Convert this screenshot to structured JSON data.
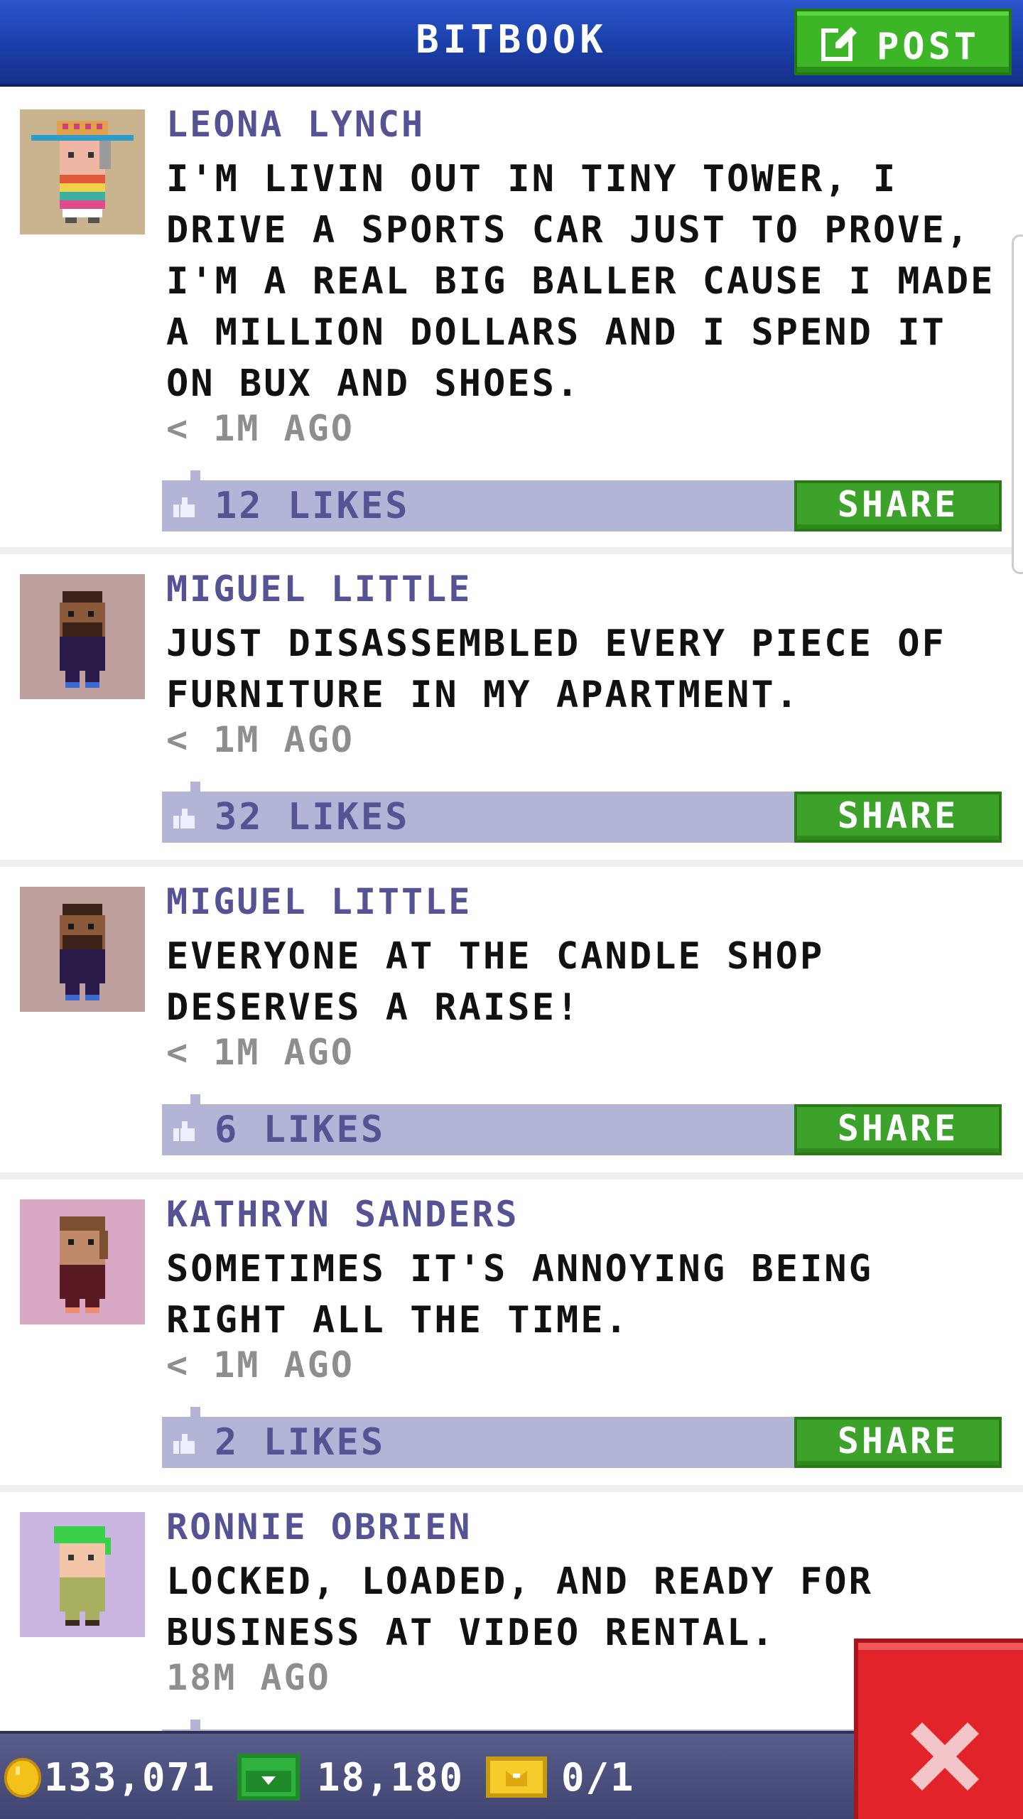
{
  "header": {
    "title": "BITBOOK",
    "post_label": "POST"
  },
  "posts": [
    {
      "author": "LEONA LYNCH",
      "message": "I'M LIVIN OUT IN TINY TOWER, I DRIVE A SPORTS CAR JUST TO PROVE, I'M A REAL BIG BALLER CAUSE I MADE A MILLION DOLLARS AND I SPEND IT ON BUX AND SHOES.",
      "time": "< 1M AGO",
      "likes": "12 LIKES",
      "share_label": "SHARE",
      "avatar_bg": "#c9b48f"
    },
    {
      "author": "MIGUEL LITTLE",
      "message": "JUST DISASSEMBLED EVERY PIECE OF FURNITURE IN MY APARTMENT.",
      "time": "< 1M AGO",
      "likes": "32 LIKES",
      "share_label": "SHARE",
      "avatar_bg": "#bda09d"
    },
    {
      "author": "MIGUEL LITTLE",
      "message": "EVERYONE AT THE CANDLE SHOP DESERVES A RAISE!",
      "time": "< 1M AGO",
      "likes": "6 LIKES",
      "share_label": "SHARE",
      "avatar_bg": "#bda09d"
    },
    {
      "author": "KATHRYN SANDERS",
      "message": "SOMETIMES IT'S ANNOYING BEING RIGHT ALL THE TIME.",
      "time": "< 1M AGO",
      "likes": "2 LIKES",
      "share_label": "SHARE",
      "avatar_bg": "#d9a8c4"
    },
    {
      "author": "RONNIE OBRIEN",
      "message": "LOCKED, LOADED, AND READY FOR BUSINESS AT VIDEO RENTAL.",
      "time": "18M AGO",
      "likes": "",
      "share_label": "",
      "avatar_bg": "#c9b5e0"
    }
  ],
  "status": {
    "coins": "133,071",
    "bux": "18,180",
    "vip": "0/1"
  },
  "colors": {
    "header_blue": "#1b3ea8",
    "accent_green": "#3da22a",
    "like_bar": "#b3b5d6",
    "author_purple": "#555394",
    "close_red": "#e0242a"
  }
}
